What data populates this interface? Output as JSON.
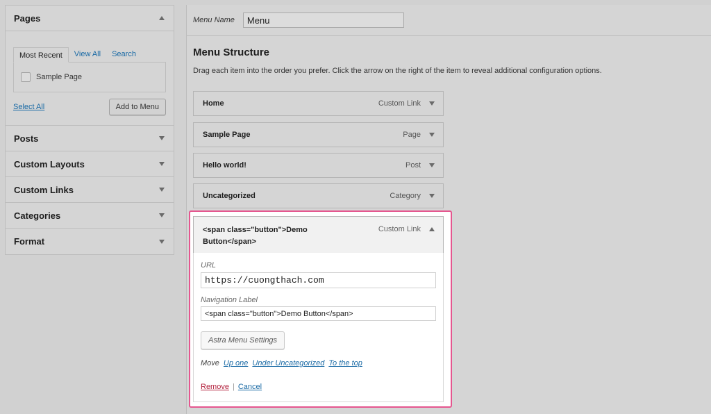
{
  "sidebar": {
    "pages": {
      "title": "Pages",
      "tabs": [
        "Most Recent",
        "View All",
        "Search"
      ],
      "items": [
        {
          "label": "Sample Page",
          "checked": false
        }
      ],
      "select_all": "Select All",
      "add_to_menu": "Add to Menu"
    },
    "sections": [
      "Posts",
      "Custom Layouts",
      "Custom Links",
      "Categories",
      "Format"
    ]
  },
  "menu_name": {
    "label": "Menu Name",
    "value": "Menu"
  },
  "structure": {
    "title": "Menu Structure",
    "description": "Drag each item into the order you prefer. Click the arrow on the right of the item to reveal additional configuration options.",
    "items": [
      {
        "title": "Home",
        "type": "Custom Link"
      },
      {
        "title": "Sample Page",
        "type": "Page"
      },
      {
        "title": "Hello world!",
        "type": "Post"
      },
      {
        "title": "Uncategorized",
        "type": "Category"
      }
    ],
    "expanded_item": {
      "title": "<span class=\"button\">Demo Button</span>",
      "type": "Custom Link",
      "url_label": "URL",
      "url_value": "https://cuongthach.com",
      "nav_label": "Navigation Label",
      "nav_value": "<span class=\"button\">Demo Button</span>",
      "astra_button": "Astra Menu Settings",
      "move_label": "Move",
      "move_links": [
        "Up one",
        "Under Uncategorized",
        "To the top"
      ],
      "remove": "Remove",
      "separator": "|",
      "cancel": "Cancel"
    }
  },
  "colors": {
    "highlight_border": "#e5568f",
    "link": "#1a6aa5",
    "remove": "#b3213d"
  }
}
